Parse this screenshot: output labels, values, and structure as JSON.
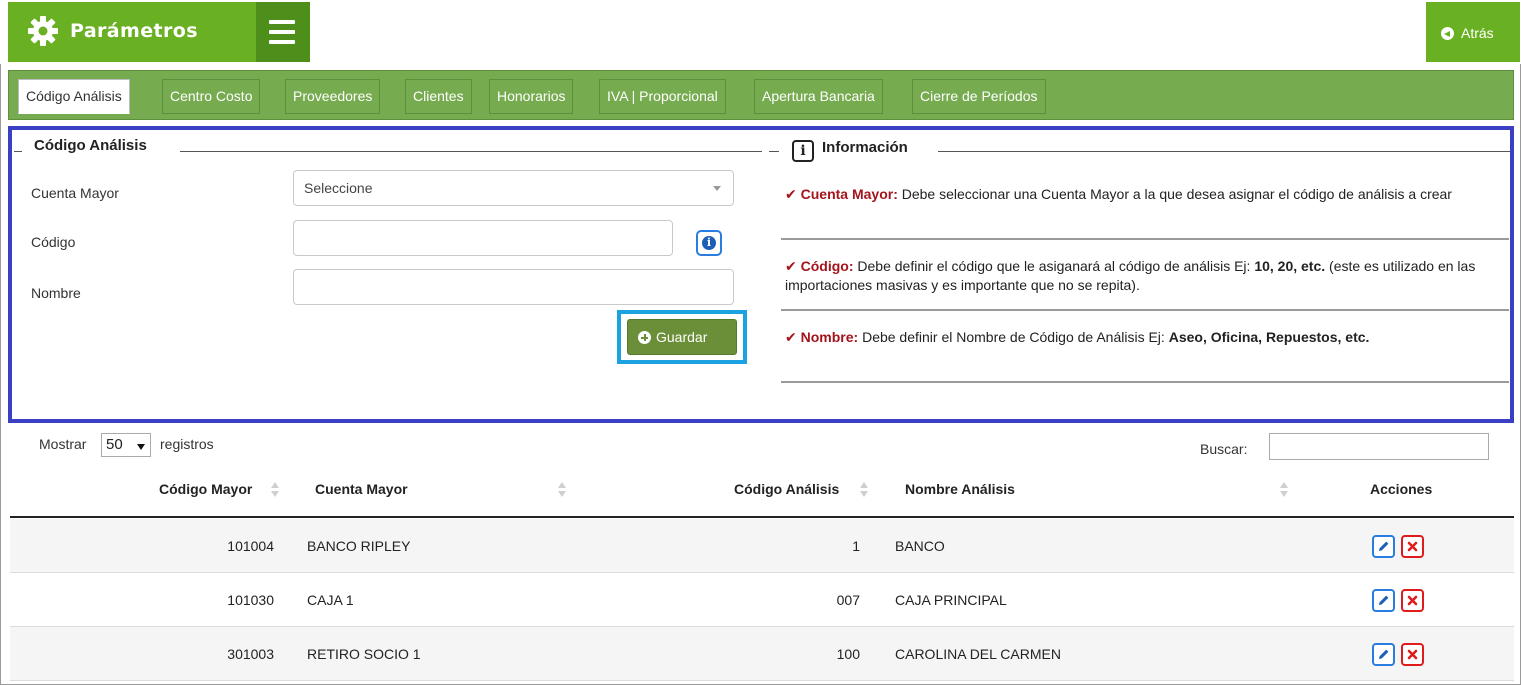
{
  "header": {
    "title": "Parámetros",
    "back_label": "Atrás",
    "colors": {
      "brand": "#6ab023",
      "menu": "#4d8f1a"
    }
  },
  "tabs": [
    {
      "label": "Código Análisis",
      "active": true
    },
    {
      "label": "Centro Costo",
      "active": false
    },
    {
      "label": "Proveedores",
      "active": false
    },
    {
      "label": "Clientes",
      "active": false
    },
    {
      "label": "Honorarios",
      "active": false
    },
    {
      "label": "IVA | Proporcional",
      "active": false
    },
    {
      "label": "Apertura Bancaria",
      "active": false
    },
    {
      "label": "Cierre de Períodos",
      "active": false
    }
  ],
  "form": {
    "legend": "Código Análisis",
    "cuenta_mayor_label": "Cuenta Mayor",
    "cuenta_mayor_value": "Seleccione",
    "codigo_label": "Código",
    "codigo_value": "",
    "nombre_label": "Nombre",
    "nombre_value": "",
    "save_label": "Guardar"
  },
  "info": {
    "legend": "Información",
    "items": [
      {
        "key": "Cuenta Mayor:",
        "text": " Debe seleccionar una Cuenta Mayor a la que desea asignar el código de análisis a crear",
        "bold": "",
        "tail": ""
      },
      {
        "key": "Código:",
        "text": " Debe definir el código que le asiganará al código de análisis Ej: ",
        "bold": "10, 20, etc.",
        "tail": " (este es utilizado en las importaciones masivas y es importante que no se repita)."
      },
      {
        "key": "Nombre:",
        "text": " Debe definir el Nombre de Código de Análisis Ej: ",
        "bold": "Aseo, Oficina, Repuestos, etc.",
        "tail": ""
      }
    ]
  },
  "table_controls": {
    "show_prefix": "Mostrar",
    "page_length": "50",
    "show_suffix": "registros",
    "search_label": "Buscar:",
    "search_value": ""
  },
  "table": {
    "columns": [
      "Código Mayor",
      "Cuenta Mayor",
      "Código Análisis",
      "Nombre Análisis",
      "Acciones"
    ],
    "rows": [
      {
        "codigo_mayor": "101004",
        "cuenta_mayor": "BANCO RIPLEY",
        "codigo_analisis": "1",
        "nombre_analisis": "BANCO"
      },
      {
        "codigo_mayor": "101030",
        "cuenta_mayor": "CAJA 1",
        "codigo_analisis": "007",
        "nombre_analisis": "CAJA PRINCIPAL"
      },
      {
        "codigo_mayor": "301003",
        "cuenta_mayor": "RETIRO SOCIO 1",
        "codigo_analisis": "100",
        "nombre_analisis": "CAROLINA DEL CARMEN"
      }
    ]
  }
}
